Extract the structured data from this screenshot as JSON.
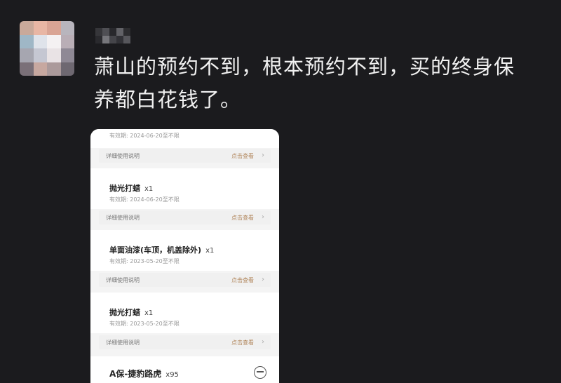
{
  "comment": {
    "line1": "萧山的预约不到，根本预约不到，买的终身保",
    "line2": "养都白花钱了。"
  },
  "card": {
    "top_validity": "有效期: 2024-06-20至不限",
    "detail_label": "详细使用说明",
    "detail_link": "点击查看",
    "items": [
      {
        "name": "抛光打蜡",
        "qty": "x1",
        "validity": "有效期: 2024-06-20至不限"
      },
      {
        "name": "单面油漆(车顶，机盖除外)",
        "qty": "x1",
        "validity": "有效期: 2023-05-20至不限"
      },
      {
        "name": "抛光打蜡",
        "qty": "x1",
        "validity": "有效期: 2023-05-20至不限"
      }
    ],
    "last_item": {
      "name": "A保-捷豹路虎",
      "qty": "x95"
    }
  },
  "icons": {
    "chevron": "chevron-right-icon",
    "circle": "minus-circle-icon"
  }
}
